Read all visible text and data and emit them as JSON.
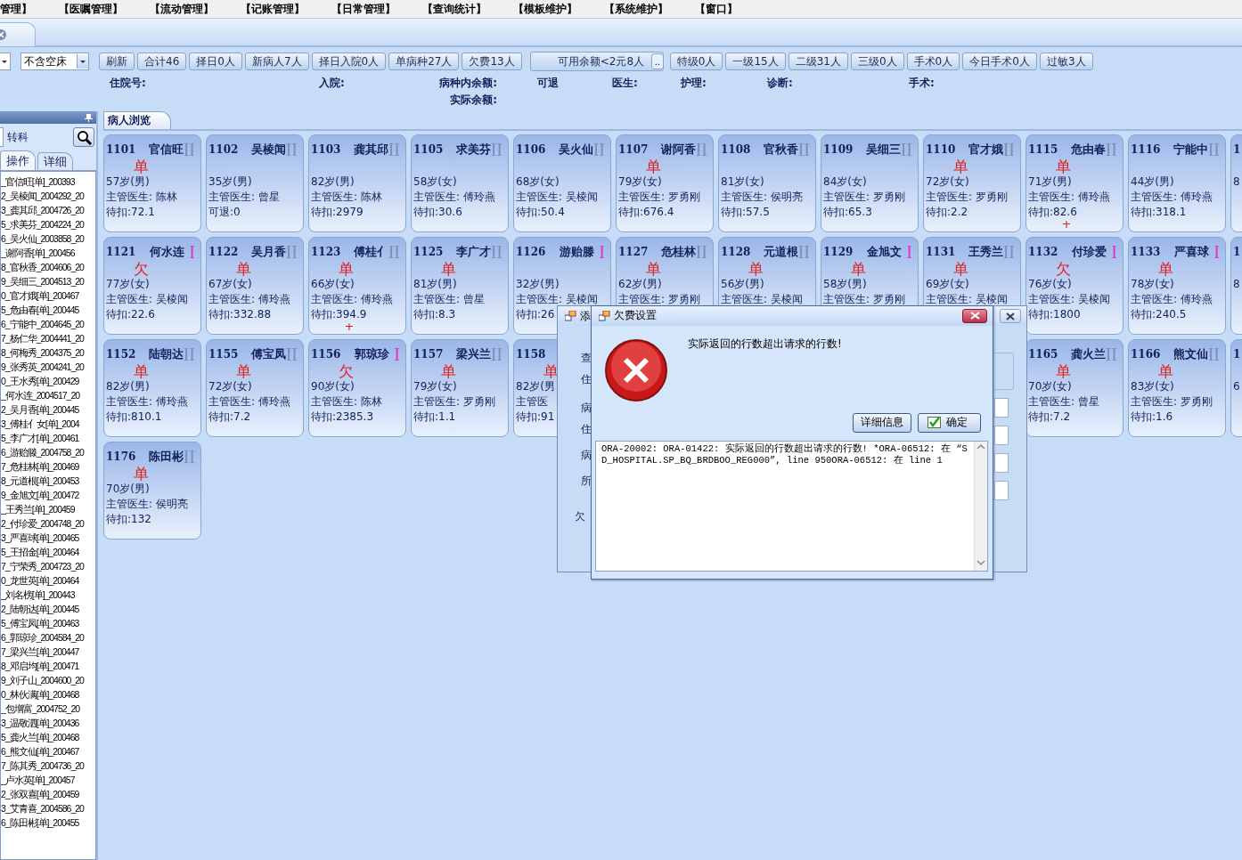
{
  "menu": [
    "管理】",
    "【医嘱管理】",
    "【流动管理】",
    "【记账管理】",
    "【日常管理】",
    "【查询统计】",
    "【模板维护】",
    "【系统维护】",
    "【窗口】"
  ],
  "toolbar": [
    {
      "kind": "combo",
      "value": "不含空床"
    },
    {
      "kind": "button",
      "label": "刷新"
    },
    {
      "kind": "button",
      "label": "合计46"
    },
    {
      "kind": "button",
      "label": "择日0人"
    },
    {
      "kind": "button",
      "label": "新病人7人"
    },
    {
      "kind": "button",
      "label": "择日入院0人"
    },
    {
      "kind": "button",
      "label": "单病种27人"
    },
    {
      "kind": "button",
      "label": "欠费13人"
    },
    {
      "kind": "picker",
      "value": "可用余额<2元8人",
      "button": ".."
    },
    {
      "kind": "button",
      "label": "特级0人"
    },
    {
      "kind": "button",
      "label": "一级15人"
    },
    {
      "kind": "button",
      "label": "二级31人"
    },
    {
      "kind": "button",
      "label": "三级0人"
    },
    {
      "kind": "button",
      "label": "手术0人"
    },
    {
      "kind": "button",
      "label": "今日手术0人"
    },
    {
      "kind": "button",
      "label": "过敏3人"
    }
  ],
  "info_labels": [
    "住院号:",
    "入院:",
    "病种内余额:",
    "可退",
    "医生:",
    "护理:",
    "诊断:",
    "手术:",
    "实际余额:"
  ],
  "sidebar": {
    "dept_label": "转科",
    "tabs": [
      {
        "label": "操作",
        "selected": true
      },
      {
        "label": "详细",
        "selected": false
      }
    ],
    "patients": [
      "_官信旺[单]_200393",
      "2_吴棱闻_2004292_20",
      "3_龚其邱_2004726_20",
      "5_求美芬_2004224_20",
      "6_吴火仙_2003858_20",
      "_谢阿香[单]_200456",
      "8_官秋香_2004606_20",
      "9_吴细三_2004513_20",
      "0_官才娥[单]_200467",
      "5_危由春[单]_200445",
      "6_宁能中_2004645_20",
      "7_杨仁华_2004441_20",
      "8_何梅秀_2004375_20",
      "9_张秀英_2004241_20",
      "0_王水秀[单]_200429",
      "_何水连_2004517_20",
      "2_吴月香[单]_200445",
      "3_傅桂亻女[单]_2004",
      "5_李广才[单]_200461",
      "6_游贻滕_2004758_20",
      "7_危桂林[单]_200469",
      "8_元道根[单]_200453",
      "9_金旭文[单]_200472",
      "_王秀兰[单]_200459",
      "2_付珍爱_2004748_20",
      "3_严喜球[单]_200465",
      "5_王招金[单]_200464",
      "7_宁荣秀_2004723_20",
      "0_龙世英[单]_200464",
      "_刘名榜[单]_200443",
      "2_陆朝达[单]_200445",
      "5_傅宝凤[单]_200463",
      "6_郭琼珍_2004584_20",
      "7_梁兴兰[单]_200447",
      "8_邓启均[单]_200471",
      "9_刘子山_2004600_20",
      "0_林伙满[单]_200468",
      "_包增富_2004752_20",
      "3_温敬泗[单]_200436",
      "5_龚火兰[单]_200468",
      "6_熊文仙[单]_200467",
      "7_陈其秀_2004736_20",
      "_卢水英[单]_200457",
      "2_张双喜[单]_200459",
      "3_艾青喜_2004586_20",
      "6_陈田彬[单]_200455"
    ]
  },
  "main_tab": {
    "label": "病人浏览",
    "selected": true
  },
  "rows": [
    {
      "cards": [
        {
          "bed": "1101",
          "name": "官信旺",
          "grade": "II",
          "color": "#7d8fb5",
          "mark": "单",
          "age": "57岁(男)",
          "doctor": "主管医生: 陈林",
          "amount": "待扣:72.1"
        },
        {
          "bed": "1102",
          "name": "吴棱闻",
          "grade": "II",
          "color": "#7d8fb5",
          "age": "35岁(男)",
          "doctor": "主管医生: 曾星",
          "amount": "可退:0"
        },
        {
          "bed": "1103",
          "name": "龚其邱",
          "grade": "II",
          "color": "#7d8fb5",
          "age": "82岁(男)",
          "doctor": "主管医生: 陈林",
          "amount": "待扣:2979"
        },
        {
          "bed": "1105",
          "name": "求美芬",
          "grade": "II",
          "color": "#7d8fb5",
          "age": "58岁(女)",
          "doctor": "主管医生: 傅玲燕",
          "amount": "待扣:30.6"
        },
        {
          "bed": "1106",
          "name": "吴火仙",
          "grade": "II",
          "color": "#7d8fb5",
          "age": "68岁(女)",
          "doctor": "主管医生: 吴棱闻",
          "amount": "待扣:50.4"
        },
        {
          "bed": "1107",
          "name": "谢阿香",
          "grade": "II",
          "color": "#7d8fb5",
          "mark": "单",
          "age": "79岁(女)",
          "doctor": "主管医生: 罗勇刚",
          "amount": "待扣:676.4"
        },
        {
          "bed": "1108",
          "name": "官秋香",
          "grade": "II",
          "color": "#7d8fb5",
          "age": "81岁(女)",
          "doctor": "主管医生: 侯明亮",
          "amount": "待扣:57.5"
        },
        {
          "bed": "1109",
          "name": "吴细三",
          "grade": "II",
          "color": "#7d8fb5",
          "age": "84岁(女)",
          "doctor": "主管医生: 罗勇刚",
          "amount": "待扣:65.3"
        },
        {
          "bed": "1110",
          "name": "官才娥",
          "grade": "II",
          "color": "#7d8fb5",
          "mark": "单",
          "age": "72岁(女)",
          "doctor": "主管医生: 罗勇刚",
          "amount": "待扣:2.2"
        },
        {
          "bed": "1115",
          "name": "危由春",
          "grade": "II",
          "color": "#7d8fb5",
          "mark": "单",
          "age": "71岁(男)",
          "doctor": "主管医生: 傅玲燕",
          "amount": "待扣:82.6",
          "flag": "+"
        },
        {
          "bed": "1116",
          "name": "宁能中",
          "grade": "II",
          "color": "#7d8fb5",
          "age": "44岁(男)",
          "doctor": "主管医生: 傅玲燕",
          "amount": "待扣:318.1"
        },
        {
          "bed": "1",
          "age": "8"
        }
      ]
    },
    {
      "cards": [
        {
          "bed": "1121",
          "name": "何水连",
          "grade": "I",
          "color": "#e030c8",
          "mark": "欠",
          "age": "77岁(女)",
          "doctor": "主管医生: 吴棱闻",
          "amount": "待扣:22.6"
        },
        {
          "bed": "1122",
          "name": "吴月香",
          "grade": "II",
          "color": "#7d8fb5",
          "mark": "单",
          "age": "67岁(女)",
          "doctor": "主管医生: 傅玲燕",
          "amount": "待扣:332.88"
        },
        {
          "bed": "1123",
          "name": "傅桂亻",
          "grade": "II",
          "color": "#7d8fb5",
          "mark": "单",
          "age": "66岁(女)",
          "doctor": "主管医生: 傅玲燕",
          "amount": "待扣:394.9",
          "flag": "+"
        },
        {
          "bed": "1125",
          "name": "李广才",
          "grade": "II",
          "color": "#7d8fb5",
          "mark": "单",
          "age": "81岁(男)",
          "doctor": "主管医生: 曾星",
          "amount": "待扣:8.3"
        },
        {
          "bed": "1126",
          "name": "游贻滕",
          "grade": "I",
          "color": "#e030c8",
          "age": "32岁(男)",
          "doctor": "主管医生: 吴棱闻",
          "amount": "待扣:26"
        },
        {
          "bed": "1127",
          "name": "危桂林",
          "grade": "II",
          "color": "#7d8fb5",
          "mark": "单",
          "age": "62岁(男)",
          "doctor": "主管医生: 罗勇刚"
        },
        {
          "bed": "1128",
          "name": "元道根",
          "grade": "II",
          "color": "#7d8fb5",
          "mark": "单",
          "age": "56岁(男)",
          "doctor": "主管医生: 吴棱闻"
        },
        {
          "bed": "1129",
          "name": "金旭文",
          "grade": "I",
          "color": "#e030c8",
          "mark": "单",
          "age": "58岁(男)",
          "doctor": "主管医生: 罗勇刚"
        },
        {
          "bed": "1131",
          "name": "王秀兰",
          "grade": "II",
          "color": "#7d8fb5",
          "mark": "单",
          "age": "69岁(女)",
          "doctor": "主管医生: 吴棱闻"
        },
        {
          "bed": "1132",
          "name": "付珍爱",
          "grade": "I",
          "color": "#e030c8",
          "mark": "欠",
          "age": "76岁(女)",
          "doctor": "主管医生: 吴棱闻",
          "amount": "待扣:1800"
        },
        {
          "bed": "1133",
          "name": "严喜球",
          "grade": "I",
          "color": "#e030c8",
          "mark": "单",
          "age": "78岁(女)",
          "doctor": "主管医生: 傅玲燕",
          "amount": "待扣:240.5"
        },
        {
          "bed": "1",
          "age": "8"
        }
      ]
    },
    {
      "cards": [
        {
          "bed": "1152",
          "name": "陆朝达",
          "grade": "II",
          "color": "#7d8fb5",
          "mark": "单",
          "age": "82岁(男)",
          "doctor": "主管医生: 傅玲燕",
          "amount": "待扣:810.1"
        },
        {
          "bed": "1155",
          "name": "傅宝凤",
          "grade": "II",
          "color": "#7d8fb5",
          "mark": "单",
          "age": "72岁(女)",
          "doctor": "主管医生: 傅玲燕",
          "amount": "待扣:7.2"
        },
        {
          "bed": "1156",
          "name": "郭琼珍",
          "grade": "I",
          "color": "#e030c8",
          "mark": "欠",
          "age": "90岁(女)",
          "doctor": "主管医生: 陈林",
          "amount": "待扣:2385.3"
        },
        {
          "bed": "1157",
          "name": "梁兴兰",
          "grade": "II",
          "color": "#7d8fb5",
          "mark": "单",
          "age": "79岁(女)",
          "doctor": "主管医生: 罗勇刚",
          "amount": "待扣:1.1"
        },
        {
          "bed": "1158",
          "mark": "单",
          "age": "82岁(男",
          "doctor": "主管医",
          "amount": "待扣:91"
        }
      ],
      "right_cards": [
        {
          "bed": "1165",
          "name": "龚火兰",
          "grade": "II",
          "color": "#7d8fb5",
          "mark": "单",
          "age": "70岁(女)",
          "doctor": "主管医生: 曾星",
          "amount": "待扣:7.2"
        },
        {
          "bed": "1166",
          "name": "熊文仙",
          "grade": "II",
          "color": "#7d8fb5",
          "mark": "单",
          "age": "83岁(女)",
          "doctor": "主管医生: 罗勇刚",
          "amount": "待扣:1.6"
        },
        {
          "bed": "1",
          "age": "6"
        }
      ]
    },
    {
      "cards": [
        {
          "bed": "1176",
          "name": "陈田彬",
          "grade": "II",
          "color": "#7d8fb5",
          "mark": "单",
          "age": "70岁(男)",
          "doctor": "主管医生: 侯明亮",
          "amount": "待扣:132"
        }
      ]
    }
  ],
  "back_dialog": {
    "title": "添",
    "labels": [
      "查",
      "住",
      "病",
      "住",
      "病",
      "所",
      "欠"
    ]
  },
  "error_dialog": {
    "title": "欠费设置",
    "message": "实际返回的行数超出请求的行数!",
    "buttons": [
      {
        "label": "详细信息",
        "kind": "plain"
      },
      {
        "label": "确定",
        "kind": "check"
      }
    ],
    "details": "ORA-20002: ORA-01422: 实际返回的行数超出请求的行数! *ORA-06512: 在 “SD_HOSPITAL.SP_BQ_BRDBOO_REG000”, line 950ORA-06512: 在 line 1"
  }
}
